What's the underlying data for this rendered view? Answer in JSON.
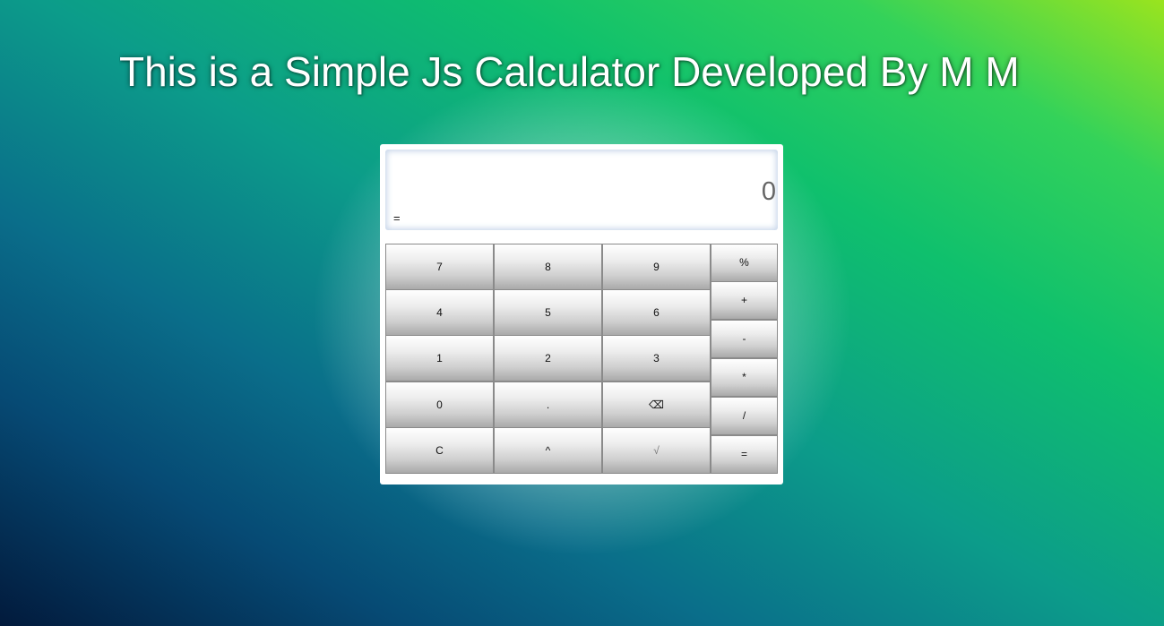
{
  "header": {
    "title": "This is a Simple Js Calculator Developed By M M"
  },
  "display": {
    "value": "0",
    "expression": "="
  },
  "keypad": {
    "k7": "7",
    "k8": "8",
    "k9": "9",
    "k4": "4",
    "k5": "5",
    "k6": "6",
    "k1": "1",
    "k2": "2",
    "k3": "3",
    "k0": "0",
    "dot": ".",
    "backspace": "⌫",
    "clear": "C",
    "power": "^",
    "sqrt": "√"
  },
  "operators": {
    "percent": "%",
    "plus": "+",
    "minus": "-",
    "multiply": "*",
    "divide": "/",
    "equals": "="
  },
  "colors": {
    "background_top_right": "#9ae41e",
    "background_mid": "#0fc06d",
    "background_bottom_left": "#021a3c",
    "display_glow": "#c9d7ea"
  }
}
